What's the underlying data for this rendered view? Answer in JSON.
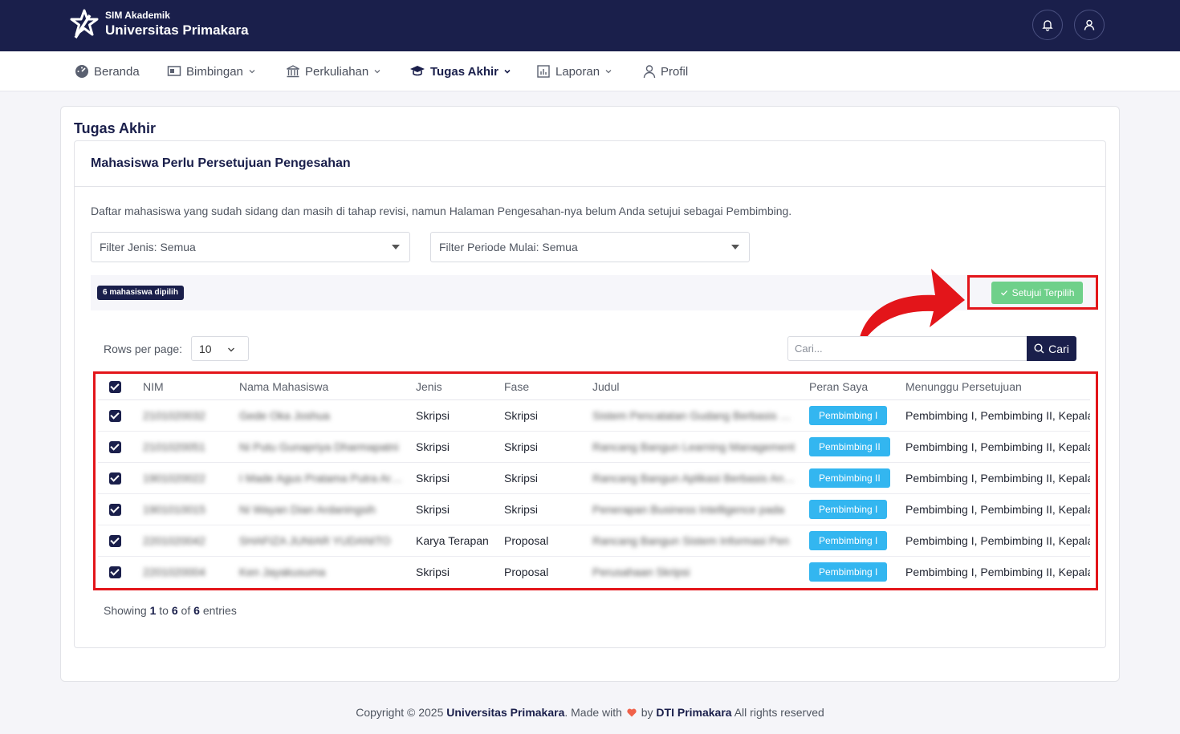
{
  "brand": {
    "subtitle": "SIM Akademik",
    "name": "Universitas Primakara"
  },
  "nav": {
    "items": [
      {
        "label": "Beranda",
        "icon": "dashboard-icon"
      },
      {
        "label": "Bimbingan",
        "icon": "presentation-icon"
      },
      {
        "label": "Perkuliahan",
        "icon": "building-icon"
      },
      {
        "label": "Tugas Akhir",
        "icon": "graduation-cap-icon"
      },
      {
        "label": "Laporan",
        "icon": "report-icon"
      },
      {
        "label": "Profil",
        "icon": "user-icon"
      }
    ]
  },
  "page": {
    "title": "Tugas Akhir"
  },
  "panel": {
    "title": "Mahasiswa Perlu Persetujuan Pengesahan",
    "description": "Daftar mahasiswa yang sudah sidang dan masih di tahap revisi, namun Halaman Pengesahan-nya belum Anda setujui sebagai Pembimbing."
  },
  "filters": {
    "jenis": "Filter Jenis: Semua",
    "periode": "Filter Periode Mulai: Semua"
  },
  "selection": {
    "count_label": "6 mahasiswa dipilih",
    "approve_label": "Setujui Terpilih"
  },
  "table_controls": {
    "rows_label": "Rows per page:",
    "rows_value": "10",
    "search_placeholder": "Cari...",
    "search_button": "Cari"
  },
  "table": {
    "headers": [
      "NIM",
      "Nama Mahasiswa",
      "Jenis",
      "Fase",
      "Judul",
      "Peran Saya",
      "Menunggu Persetujuan"
    ],
    "rows": [
      {
        "nim": "2101020032",
        "nama": "Gede Oka Joshua",
        "jenis": "Skripsi",
        "fase": "Skripsi",
        "judul": "Sistem Pencatatan Gudang Berbasis Web",
        "peran": "Pembimbing I",
        "menunggu": "Pembimbing I, Pembimbing II, Kepala"
      },
      {
        "nim": "2101020051",
        "nama": "Ni Putu Gunapriya Dharmapatni",
        "jenis": "Skripsi",
        "fase": "Skripsi",
        "judul": "Rancang Bangun Learning Management",
        "peran": "Pembimbing II",
        "menunggu": "Pembimbing I, Pembimbing II, Kepala"
      },
      {
        "nim": "1901020022",
        "nama": "I Made Agus Pratama Putra Arnata",
        "jenis": "Skripsi",
        "fase": "Skripsi",
        "judul": "Rancang Bangun Aplikasi Berbasis Android",
        "peran": "Pembimbing II",
        "menunggu": "Pembimbing I, Pembimbing II, Kepala"
      },
      {
        "nim": "1901010015",
        "nama": "Ni Wayan Dian Ardaningsih",
        "jenis": "Skripsi",
        "fase": "Skripsi",
        "judul": "Penerapan Business Intelligence pada",
        "peran": "Pembimbing I",
        "menunggu": "Pembimbing I, Pembimbing II, Kepala"
      },
      {
        "nim": "2201020042",
        "nama": "SHAFIZA JUNIAR YUDANITO",
        "jenis": "Karya Terapan",
        "fase": "Proposal",
        "judul": "Rancang Bangun Sistem Informasi Pen",
        "peran": "Pembimbing I",
        "menunggu": "Pembimbing I, Pembimbing II, Kepala"
      },
      {
        "nim": "2201020004",
        "nama": "Ken Jayakusuma",
        "jenis": "Skripsi",
        "fase": "Proposal",
        "judul": "Perusahaan Skripsi",
        "peran": "Pembimbing I",
        "menunggu": "Pembimbing I, Pembimbing II, Kepala"
      }
    ]
  },
  "pagination": {
    "prefix": "Showing",
    "from": "1",
    "to_word": "to",
    "to": "6",
    "of_word": "of",
    "total": "6",
    "suffix": "entries"
  },
  "footer": {
    "copyright": "Copyright © 2025",
    "org": "Universitas Primakara",
    "made_with": ". Made with",
    "by": "by",
    "team": "DTI Primakara",
    "rights": "All rights reserved"
  },
  "colors": {
    "primary": "#1a1f4b",
    "approve": "#6fd08a",
    "role_badge": "#33b6f0",
    "highlight": "#e3151a"
  }
}
